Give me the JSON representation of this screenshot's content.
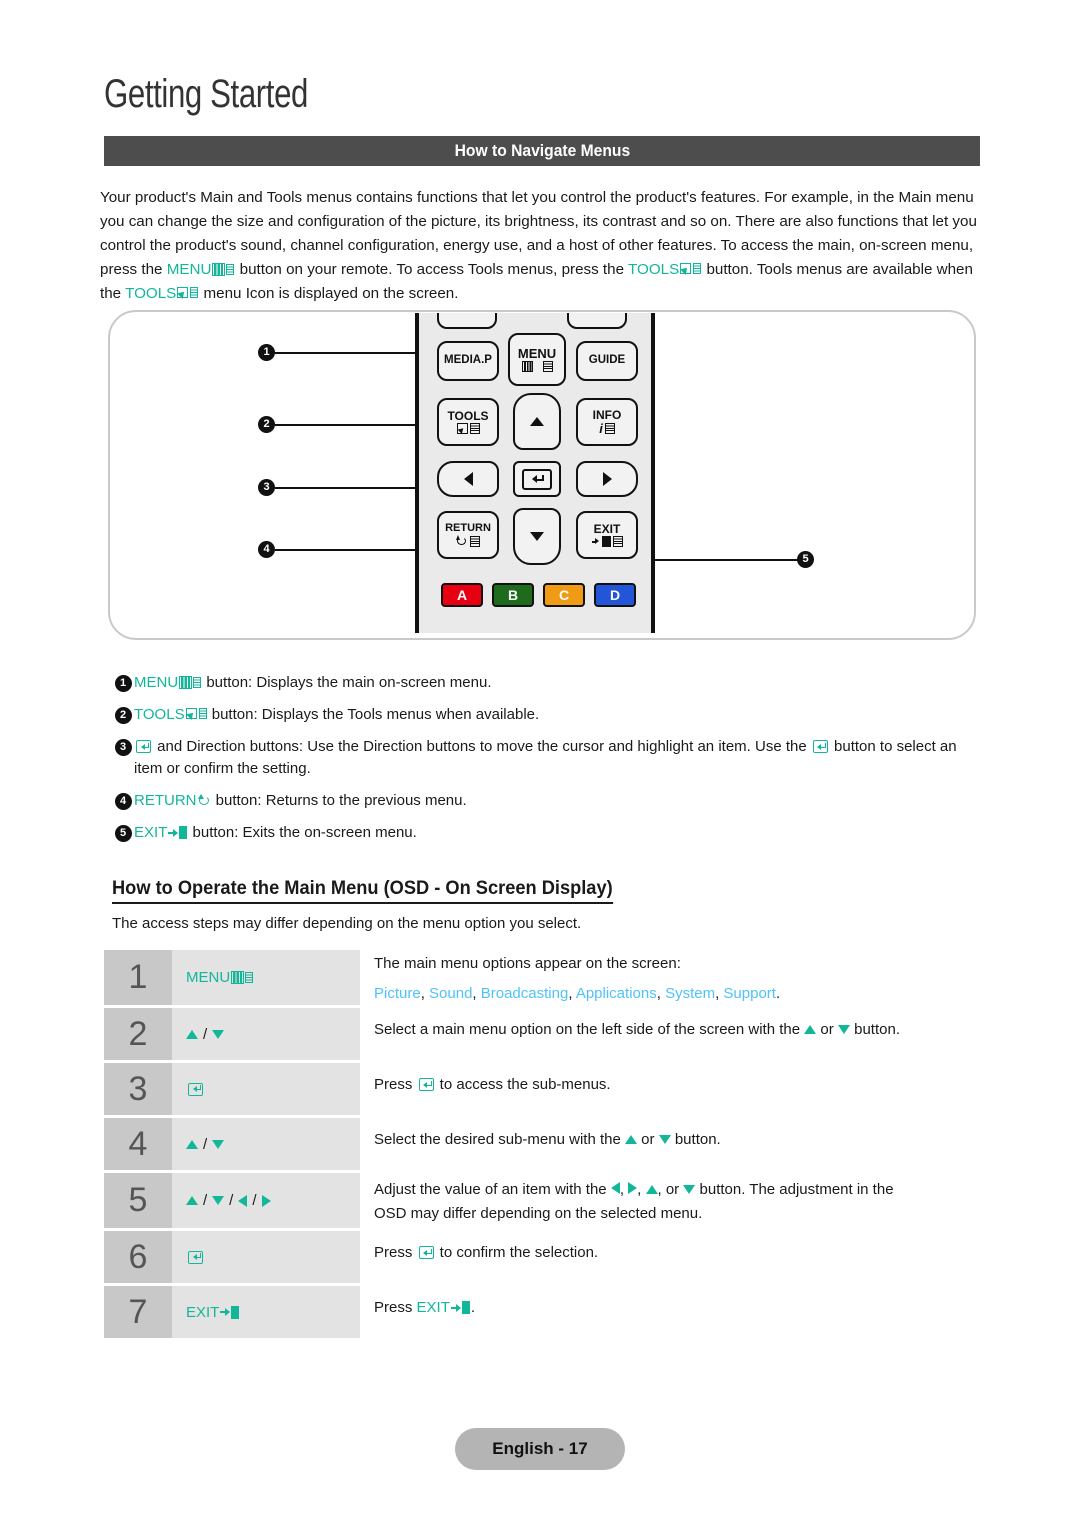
{
  "header": {
    "chapter_title": "Getting Started",
    "section_bar_title": "How to Navigate Menus"
  },
  "intro": {
    "line_1": "Your product's Main and Tools menus contains functions that let you control the product's features. For example, in the",
    "line_2": "Main menu you can change the size and configuration of the picture, its brightness, its contrast and so on. There are",
    "line_3": "also functions that let you control the product's sound, channel configuration, energy use, and a host of other features.",
    "line_4_a": "To access the main, on-screen menu, press the ",
    "line_4_menu": "MENU",
    "line_4_b": " button on your remote. To access Tools menus, press the",
    "line_5_tools": "TOOLS",
    "line_5_a": " button. Tools menus are available when the ",
    "line_5_tools2": "TOOLS",
    "line_5_b": " menu Icon is displayed on the screen."
  },
  "remote": {
    "buttons": {
      "media_p": "MEDIA.P",
      "menu": "MENU",
      "guide": "GUIDE",
      "tools": "TOOLS",
      "info": "INFO",
      "info_i": "i",
      "return": "RETURN",
      "exit": "EXIT"
    },
    "color_buttons": [
      {
        "label": "A",
        "color": "#e60012"
      },
      {
        "label": "B",
        "color": "#1e6b1e"
      },
      {
        "label": "C",
        "color": "#ef9b16"
      },
      {
        "label": "D",
        "color": "#2255d8"
      }
    ],
    "callouts": [
      "1",
      "2",
      "3",
      "4",
      "5"
    ]
  },
  "explanations": [
    {
      "num": "1",
      "key": "MENU",
      "icon": "menu-icon",
      "text": " button: Displays the main on-screen menu."
    },
    {
      "num": "2",
      "key": "TOOLS",
      "icon": "tools-icon",
      "text": " button: Displays the Tools menus when available."
    },
    {
      "num": "3",
      "key": "",
      "icon": "enter-icon",
      "text_a": " and Direction buttons: Use the Direction buttons to move the cursor and highlight an item. Use the ",
      "text_b": " button to select an item or confirm the setting."
    },
    {
      "num": "4",
      "key": "RETURN",
      "icon": "return-icon",
      "text": " button: Returns to the previous menu."
    },
    {
      "num": "5",
      "key": "EXIT",
      "icon": "exit-icon",
      "text": " button: Exits the on-screen menu."
    }
  ],
  "operate_section": {
    "heading": "How to Operate the Main Menu (OSD - On Screen Display)",
    "note": "The access steps may differ depending on the menu option you select."
  },
  "steps": [
    {
      "num": "1",
      "key_label": "MENU",
      "key_icon": "menu-icon",
      "desc_line1": "The main menu options appear on the screen:",
      "menu_options": [
        "Picture",
        "Sound",
        "Broadcasting",
        "Applications",
        "System",
        "Support"
      ],
      "menu_options_trailing": "."
    },
    {
      "num": "2",
      "key_label": "",
      "key_icon": "up-down-arrows",
      "desc_a": "Select a main menu option on the left side of the screen with the ",
      "desc_mid": " or ",
      "desc_b": " button."
    },
    {
      "num": "3",
      "key_label": "",
      "key_icon": "enter-icon",
      "desc_a": "Press ",
      "desc_b": " to access the sub-menus."
    },
    {
      "num": "4",
      "key_label": "",
      "key_icon": "up-down-arrows",
      "desc_a": "Select the desired sub-menu with the ",
      "desc_mid": " or ",
      "desc_b": " button."
    },
    {
      "num": "5",
      "key_label": "",
      "key_icon": "four-direction-arrows",
      "desc_a": "Adjust the value of an item with the ",
      "desc_b": ", ",
      "desc_c": ", ",
      "desc_d": ", or ",
      "desc_e": " button. The adjustment in the",
      "desc_line2": "OSD may differ depending on the selected menu."
    },
    {
      "num": "6",
      "key_label": "",
      "key_icon": "enter-icon",
      "desc_a": "Press ",
      "desc_b": " to confirm the selection."
    },
    {
      "num": "7",
      "key_label": "EXIT",
      "key_icon": "exit-icon",
      "desc_a": "Press ",
      "desc_key": "EXIT",
      "desc_b": "."
    }
  ],
  "footer": {
    "page_label": "English - 17"
  },
  "colors": {
    "accent_teal": "#12b79a",
    "accent_sky": "#4fc3f7",
    "section_bar_bg": "#4d4d4d",
    "step_num_bg": "#c8c8c8",
    "step_key_bg": "#e3e3e3",
    "footer_bg": "#b4b4b4"
  }
}
